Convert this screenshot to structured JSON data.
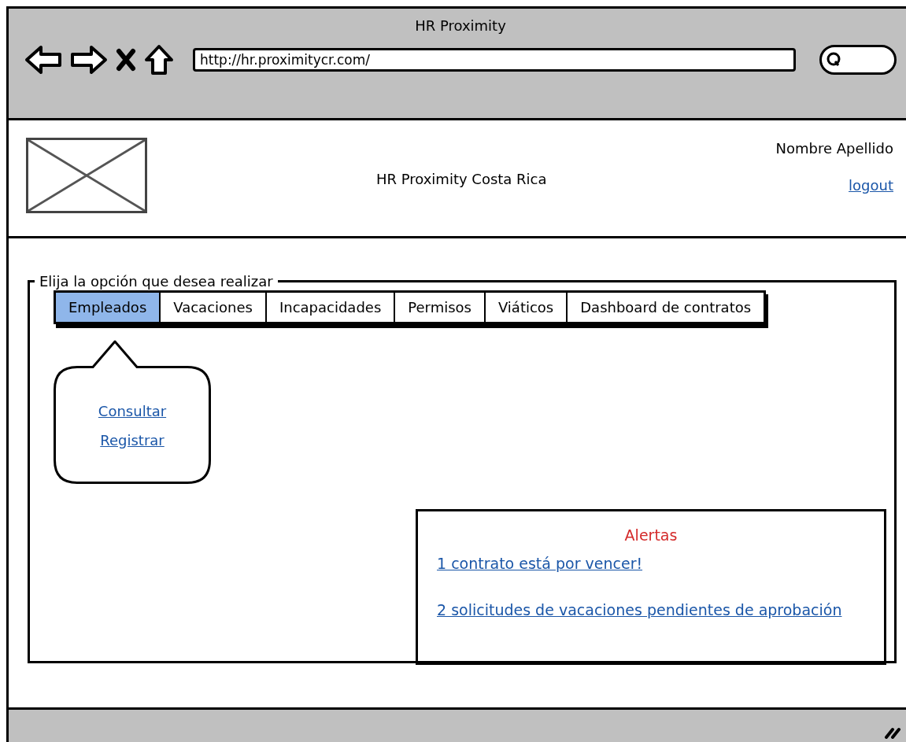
{
  "window": {
    "title": "HR Proximity"
  },
  "address_bar": {
    "value": "http://hr.proximitycr.com/"
  },
  "header": {
    "title": "HR Proximity Costa Rica",
    "user_name": "Nombre Apellido",
    "logout": "logout"
  },
  "options": {
    "legend": "Elija la opción que desea realizar",
    "tabs": [
      {
        "label": "Empleados",
        "selected": true
      },
      {
        "label": "Vacaciones",
        "selected": false
      },
      {
        "label": "Incapacidades",
        "selected": false
      },
      {
        "label": "Permisos",
        "selected": false
      },
      {
        "label": "Viáticos",
        "selected": false
      },
      {
        "label": "Dashboard de contratos",
        "selected": false
      }
    ],
    "popup_links": [
      "Consultar",
      "Registrar"
    ]
  },
  "alerts": {
    "title": "Alertas",
    "items": [
      "1 contrato está por vencer!",
      "2 solicitudes de vacaciones pendientes de aprobación"
    ]
  }
}
